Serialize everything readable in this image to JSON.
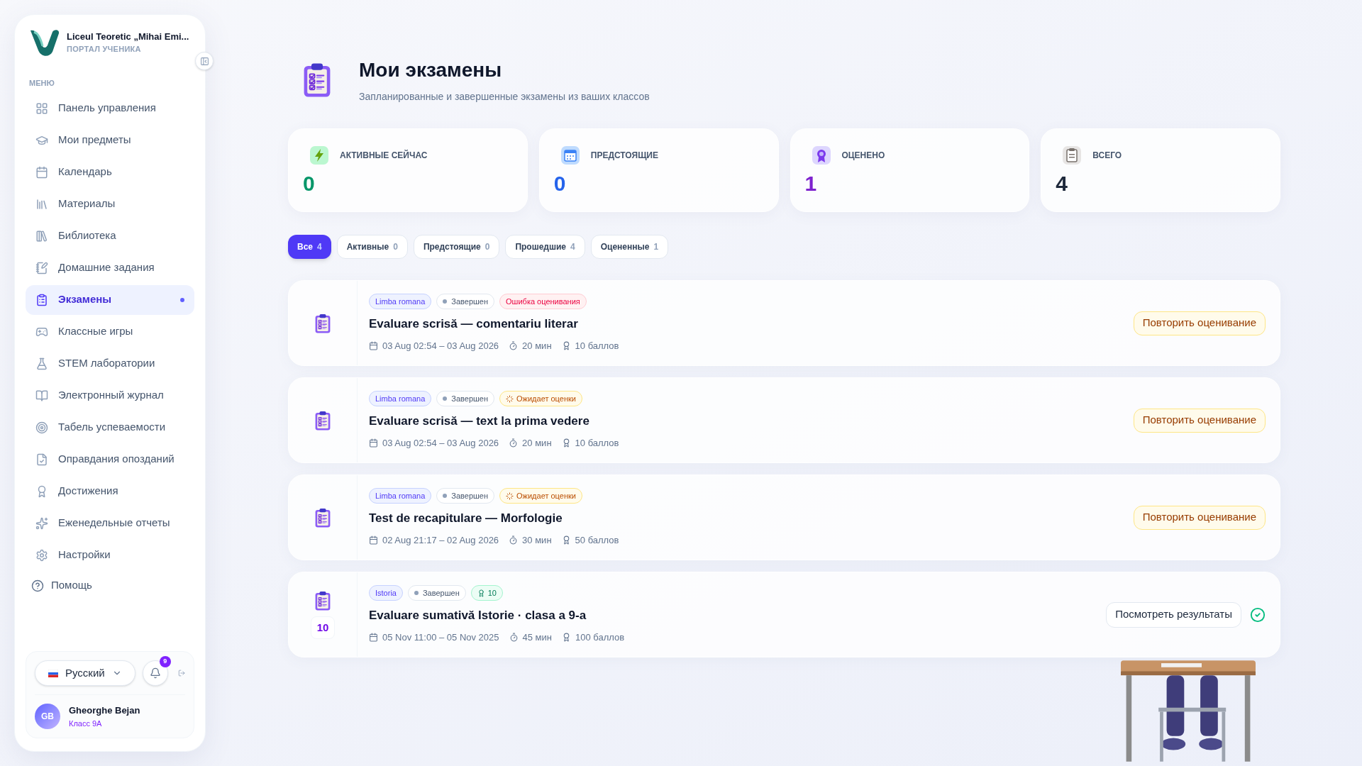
{
  "sidebar": {
    "school": "Liceul Teoretic „Mihai Emi...",
    "portal": "ПОРТАЛ УЧЕНИКА",
    "menu_label": "МЕНЮ",
    "items": [
      {
        "label": "Панель управления",
        "selected": false
      },
      {
        "label": "Мои предметы",
        "selected": false
      },
      {
        "label": "Календарь",
        "selected": false
      },
      {
        "label": "Материалы",
        "selected": false
      },
      {
        "label": "Библиотека",
        "selected": false
      },
      {
        "label": "Домашние задания",
        "selected": false
      },
      {
        "label": "Экзамены",
        "selected": true
      },
      {
        "label": "Классные игры",
        "selected": false
      },
      {
        "label": "STEM лаборатории",
        "selected": false
      },
      {
        "label": "Электронный журнал",
        "selected": false
      },
      {
        "label": "Табель успеваемости",
        "selected": false
      },
      {
        "label": "Оправдания опозданий",
        "selected": false
      },
      {
        "label": "Достижения",
        "selected": false
      },
      {
        "label": "Еженедельные отчеты",
        "selected": false
      },
      {
        "label": "Настройки",
        "selected": false
      }
    ],
    "help": "Помощь",
    "language": "Русский",
    "notifications": "9",
    "user": {
      "initials": "GB",
      "name": "Gheorghe Bejan",
      "class": "Класс 9А"
    }
  },
  "header": {
    "title": "Мои экзамены",
    "subtitle": "Запланированные и завершенные экзамены из ваших классов"
  },
  "stats": [
    {
      "label": "АКТИВНЫЕ СЕЙЧАС",
      "value": "0",
      "color": "#059669"
    },
    {
      "label": "ПРЕДСТОЯЩИЕ",
      "value": "0",
      "color": "#2563eb"
    },
    {
      "label": "ОЦЕНЕНО",
      "value": "1",
      "color": "#7e22ce"
    },
    {
      "label": "ВСЕГО",
      "value": "4",
      "color": "#1e293b"
    }
  ],
  "filters": [
    {
      "label": "Все",
      "count": "4",
      "selected": true
    },
    {
      "label": "Активные",
      "count": "0",
      "selected": false
    },
    {
      "label": "Предстоящие",
      "count": "0",
      "selected": false
    },
    {
      "label": "Прошедшие",
      "count": "4",
      "selected": false
    },
    {
      "label": "Оцененные",
      "count": "1",
      "selected": false
    }
  ],
  "exams": [
    {
      "subject": "Limba romana",
      "status": "Завершен",
      "badge": {
        "kind": "error",
        "text": "Ошибка оценивания"
      },
      "title": "Evaluare scrisă — comentariu literar",
      "dates": "03 Aug 02:54 – 03 Aug 2026",
      "duration": "20 мин",
      "points": "10 баллов",
      "action": {
        "kind": "retry",
        "label": "Повторить оценивание"
      }
    },
    {
      "subject": "Limba romana",
      "status": "Завершен",
      "badge": {
        "kind": "pending",
        "text": "Ожидает оценки"
      },
      "title": "Evaluare scrisă — text la prima vedere",
      "dates": "03 Aug 02:54 – 03 Aug 2026",
      "duration": "20 мин",
      "points": "10 баллов",
      "action": {
        "kind": "retry",
        "label": "Повторить оценивание"
      }
    },
    {
      "subject": "Limba romana",
      "status": "Завершен",
      "badge": {
        "kind": "pending",
        "text": "Ожидает оценки"
      },
      "title": "Test de recapitulare — Morfologie",
      "dates": "02 Aug 21:17 – 02 Aug 2026",
      "duration": "30 мин",
      "points": "50 баллов",
      "action": {
        "kind": "retry",
        "label": "Повторить оценивание"
      }
    },
    {
      "subject": "Istoria",
      "status": "Завершен",
      "badge": {
        "kind": "score",
        "text": "10"
      },
      "score": "10",
      "title": "Evaluare sumativă Istorie · clasa a 9-a",
      "dates": "05 Nov 11:00 – 05 Nov 2025",
      "duration": "45 мин",
      "points": "100 баллов",
      "action": {
        "kind": "results",
        "label": "Посмотреть результаты"
      }
    }
  ]
}
